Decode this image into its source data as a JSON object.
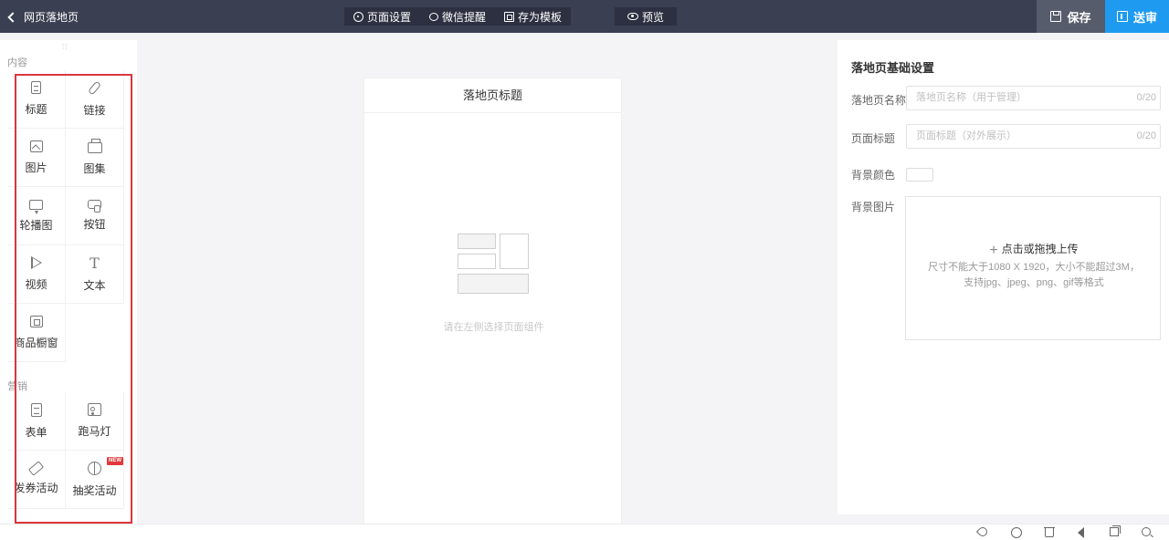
{
  "topbar": {
    "back_label": "网页落地页",
    "actions": [
      {
        "label": "页面设置",
        "icon": "gear-icon"
      },
      {
        "label": "微信提醒",
        "icon": "wechat-icon"
      },
      {
        "label": "存为模板",
        "icon": "template-icon"
      }
    ],
    "preview": {
      "label": "预览",
      "icon": "eye-icon"
    },
    "save_label": "保存",
    "submit_label": "送审",
    "accent_color": "#1e9bf0"
  },
  "left_panel": {
    "content_section": "内容",
    "content_components": [
      {
        "label": "标题",
        "icon": "title-icon"
      },
      {
        "label": "链接",
        "icon": "link-icon"
      },
      {
        "label": "图片",
        "icon": "image-icon"
      },
      {
        "label": "图集",
        "icon": "album-icon"
      },
      {
        "label": "轮播图",
        "icon": "carousel-icon"
      },
      {
        "label": "按钮",
        "icon": "button-icon"
      },
      {
        "label": "视频",
        "icon": "video-icon"
      },
      {
        "label": "文本",
        "icon": "text-icon",
        "glyph": "T"
      },
      {
        "label": "商品橱窗",
        "icon": "shop-window-icon"
      }
    ],
    "marketing_section": "营销",
    "marketing_components": [
      {
        "label": "表单",
        "icon": "form-icon"
      },
      {
        "label": "跑马灯",
        "icon": "marquee-icon"
      },
      {
        "label": "发券活动",
        "icon": "coupon-icon"
      },
      {
        "label": "抽奖活动",
        "icon": "lottery-icon",
        "badge": "NEW"
      }
    ],
    "highlight_color": "#d9363e"
  },
  "canvas": {
    "page_title": "落地页标题",
    "empty_hint": "请在左侧选择页面组件"
  },
  "right_panel": {
    "title": "落地页基础设置",
    "fields": {
      "name": {
        "label": "落地页名称",
        "placeholder": "落地页名称（用于管理）",
        "count": "0/20"
      },
      "page_title": {
        "label": "页面标题",
        "placeholder": "页面标题（对外展示）",
        "count": "0/20"
      },
      "bg_color": {
        "label": "背景颜色",
        "value": "#ffffff"
      },
      "bg_image": {
        "label": "背景图片",
        "upload_label": "点击或拖拽上传",
        "hint_line1": "尺寸不能大于1080 X 1920，大小不能超过3M，",
        "hint_line2": "支持jpg、jpeg、png、gif等格式"
      }
    }
  },
  "bottom_bar": {
    "icons": [
      "rocket-icon",
      "clean-icon",
      "trash-icon",
      "sound-icon",
      "window-icon",
      "search-icon"
    ]
  }
}
